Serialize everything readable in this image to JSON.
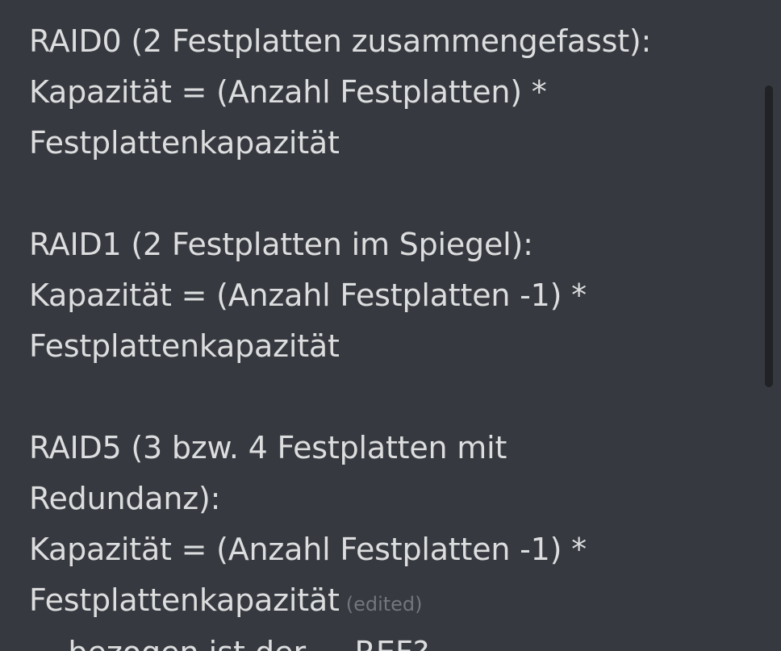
{
  "message": {
    "raid0": {
      "title": "RAID0 (2 Festplatten zusammengefasst):",
      "formula": "Kapazität = (Anzahl Festplatten) *",
      "unit": "Festplattenkapazität"
    },
    "raid1": {
      "title": "RAID1 (2 Festplatten im Spiegel):",
      "formula": "Kapazität = (Anzahl Festplatten -1) *",
      "unit": "Festplattenkapazität"
    },
    "raid5": {
      "title_line1": "RAID5 (3 bzw. 4 Festplatten mit",
      "title_line2": "Redundanz):",
      "formula": "Kapazität = (Anzahl Festplatten -1) *",
      "unit": "Festplattenkapazität"
    },
    "edited_label": "(edited)"
  },
  "next_message_partial": "... bezogen ist der ... REF?",
  "colors": {
    "background": "#36393f",
    "text": "#dcddde",
    "muted": "#72767d",
    "scrollbar": "#202225"
  }
}
